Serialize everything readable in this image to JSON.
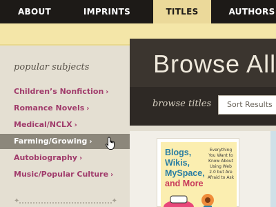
{
  "nav": {
    "items": [
      {
        "label": "ABOUT",
        "active": false
      },
      {
        "label": "IMPRINTS",
        "active": false
      },
      {
        "label": "TITLES",
        "active": true
      },
      {
        "label": "AUTHORS",
        "active": false
      }
    ]
  },
  "sidebar": {
    "heading": "popular subjects",
    "items": [
      {
        "label": "Children’s Nonfiction",
        "active": false
      },
      {
        "label": "Romance Novels",
        "active": false
      },
      {
        "label": "Medical/NCLX",
        "active": false
      },
      {
        "label": "Farming/Growing",
        "active": true
      },
      {
        "label": "Autobiography",
        "active": false
      },
      {
        "label": "Music/Popular Culture",
        "active": false
      }
    ],
    "chevron": "›"
  },
  "main": {
    "title": "Browse All",
    "subbar_label": "browse titles",
    "sort_placeholder": "Sort Results"
  },
  "book": {
    "title_lines": [
      "Blogs,",
      "Wikis,",
      "MySpace,"
    ],
    "title_accent": "and More",
    "subtitle": "Everything You Want to Know About Using Web 2.0 but Are Afraid to Ask"
  },
  "colors": {
    "nav_bg": "#1d1a17",
    "nav_active": "#ebd99a",
    "stripe": "#f4e6a8",
    "link": "#a03b6b",
    "sidebar_active": "#8c877b",
    "browse_bg": "#3b352f"
  },
  "icons": [
    "hand-pointer-cursor-icon",
    "divider-ornament-icon"
  ]
}
